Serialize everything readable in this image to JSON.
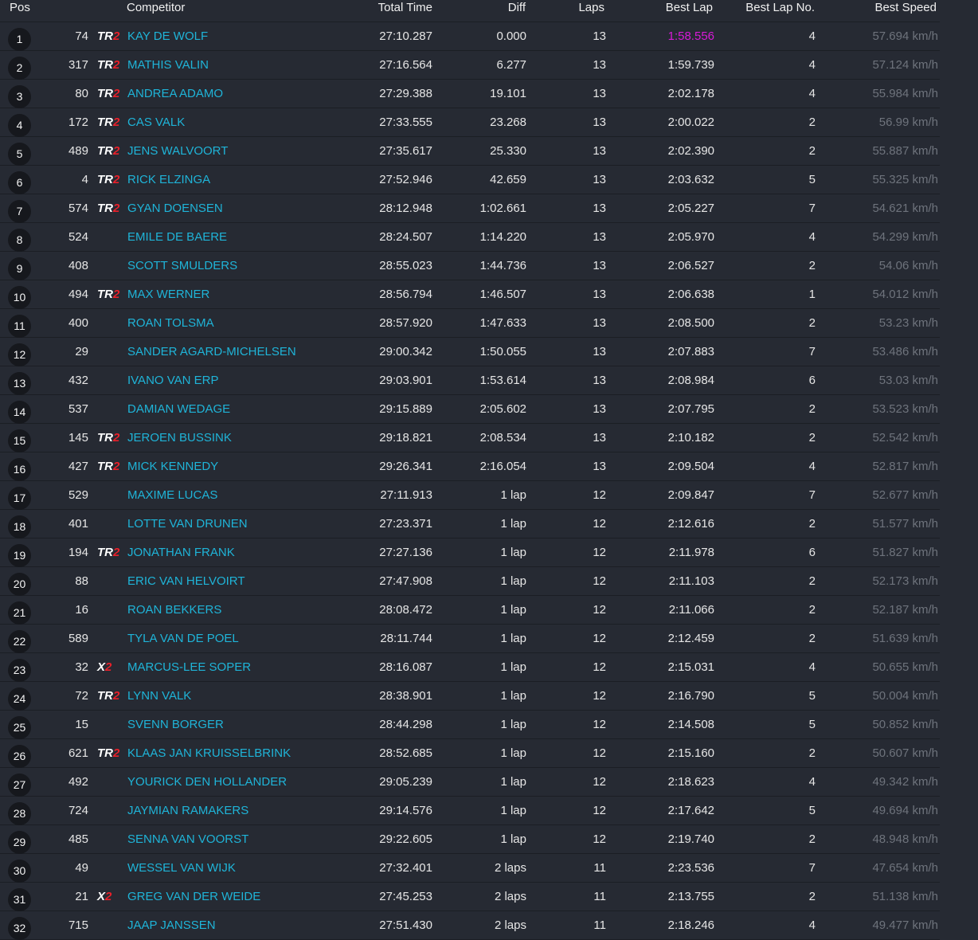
{
  "headers": {
    "pos": "Pos",
    "competitor": "Competitor",
    "total_time": "Total Time",
    "diff": "Diff",
    "laps": "Laps",
    "best_lap": "Best Lap",
    "best_lap_no": "Best Lap No.",
    "best_speed": "Best Speed"
  },
  "colors": {
    "name": "#1fb4d8",
    "fastest_lap": "#d81ad8",
    "class_red": "#e8202a",
    "speed": "#6e737c"
  },
  "rows": [
    {
      "pos": "1",
      "num": "74",
      "cls_a": "TR",
      "cls_b": "2",
      "name": "KAY DE WOLF",
      "total": "27:10.287",
      "diff": "0.000",
      "laps": "13",
      "best": "1:58.556",
      "best_no": "4",
      "speed": "57.694 km/h",
      "fastest": true
    },
    {
      "pos": "2",
      "num": "317",
      "cls_a": "TR",
      "cls_b": "2",
      "name": "MATHIS VALIN",
      "total": "27:16.564",
      "diff": "6.277",
      "laps": "13",
      "best": "1:59.739",
      "best_no": "4",
      "speed": "57.124 km/h"
    },
    {
      "pos": "3",
      "num": "80",
      "cls_a": "TR",
      "cls_b": "2",
      "name": "ANDREA ADAMO",
      "total": "27:29.388",
      "diff": "19.101",
      "laps": "13",
      "best": "2:02.178",
      "best_no": "4",
      "speed": "55.984 km/h"
    },
    {
      "pos": "4",
      "num": "172",
      "cls_a": "TR",
      "cls_b": "2",
      "name": "CAS VALK",
      "total": "27:33.555",
      "diff": "23.268",
      "laps": "13",
      "best": "2:00.022",
      "best_no": "2",
      "speed": "56.99 km/h"
    },
    {
      "pos": "5",
      "num": "489",
      "cls_a": "TR",
      "cls_b": "2",
      "name": "JENS WALVOORT",
      "total": "27:35.617",
      "diff": "25.330",
      "laps": "13",
      "best": "2:02.390",
      "best_no": "2",
      "speed": "55.887 km/h"
    },
    {
      "pos": "6",
      "num": "4",
      "cls_a": "TR",
      "cls_b": "2",
      "name": "RICK ELZINGA",
      "total": "27:52.946",
      "diff": "42.659",
      "laps": "13",
      "best": "2:03.632",
      "best_no": "5",
      "speed": "55.325 km/h"
    },
    {
      "pos": "7",
      "num": "574",
      "cls_a": "TR",
      "cls_b": "2",
      "name": "GYAN DOENSEN",
      "total": "28:12.948",
      "diff": "1:02.661",
      "laps": "13",
      "best": "2:05.227",
      "best_no": "7",
      "speed": "54.621 km/h"
    },
    {
      "pos": "8",
      "num": "524",
      "cls_a": "",
      "cls_b": "",
      "name": "EMILE DE BAERE",
      "total": "28:24.507",
      "diff": "1:14.220",
      "laps": "13",
      "best": "2:05.970",
      "best_no": "4",
      "speed": "54.299 km/h"
    },
    {
      "pos": "9",
      "num": "408",
      "cls_a": "",
      "cls_b": "",
      "name": "SCOTT SMULDERS",
      "total": "28:55.023",
      "diff": "1:44.736",
      "laps": "13",
      "best": "2:06.527",
      "best_no": "2",
      "speed": "54.06 km/h"
    },
    {
      "pos": "10",
      "num": "494",
      "cls_a": "TR",
      "cls_b": "2",
      "name": "MAX WERNER",
      "total": "28:56.794",
      "diff": "1:46.507",
      "laps": "13",
      "best": "2:06.638",
      "best_no": "1",
      "speed": "54.012 km/h"
    },
    {
      "pos": "11",
      "num": "400",
      "cls_a": "",
      "cls_b": "",
      "name": "ROAN TOLSMA",
      "total": "28:57.920",
      "diff": "1:47.633",
      "laps": "13",
      "best": "2:08.500",
      "best_no": "2",
      "speed": "53.23 km/h"
    },
    {
      "pos": "12",
      "num": "29",
      "cls_a": "",
      "cls_b": "",
      "name": "SANDER AGARD-MICHELSEN",
      "total": "29:00.342",
      "diff": "1:50.055",
      "laps": "13",
      "best": "2:07.883",
      "best_no": "7",
      "speed": "53.486 km/h"
    },
    {
      "pos": "13",
      "num": "432",
      "cls_a": "",
      "cls_b": "",
      "name": "IVANO VAN ERP",
      "total": "29:03.901",
      "diff": "1:53.614",
      "laps": "13",
      "best": "2:08.984",
      "best_no": "6",
      "speed": "53.03 km/h"
    },
    {
      "pos": "14",
      "num": "537",
      "cls_a": "",
      "cls_b": "",
      "name": "DAMIAN WEDAGE",
      "total": "29:15.889",
      "diff": "2:05.602",
      "laps": "13",
      "best": "2:07.795",
      "best_no": "2",
      "speed": "53.523 km/h"
    },
    {
      "pos": "15",
      "num": "145",
      "cls_a": "TR",
      "cls_b": "2",
      "name": "JEROEN BUSSINK",
      "total": "29:18.821",
      "diff": "2:08.534",
      "laps": "13",
      "best": "2:10.182",
      "best_no": "2",
      "speed": "52.542 km/h"
    },
    {
      "pos": "16",
      "num": "427",
      "cls_a": "TR",
      "cls_b": "2",
      "name": "MICK KENNEDY",
      "total": "29:26.341",
      "diff": "2:16.054",
      "laps": "13",
      "best": "2:09.504",
      "best_no": "4",
      "speed": "52.817 km/h"
    },
    {
      "pos": "17",
      "num": "529",
      "cls_a": "",
      "cls_b": "",
      "name": "MAXIME LUCAS",
      "total": "27:11.913",
      "diff": "1 lap",
      "laps": "12",
      "best": "2:09.847",
      "best_no": "7",
      "speed": "52.677 km/h"
    },
    {
      "pos": "18",
      "num": "401",
      "cls_a": "",
      "cls_b": "",
      "name": "LOTTE VAN DRUNEN",
      "total": "27:23.371",
      "diff": "1 lap",
      "laps": "12",
      "best": "2:12.616",
      "best_no": "2",
      "speed": "51.577 km/h"
    },
    {
      "pos": "19",
      "num": "194",
      "cls_a": "TR",
      "cls_b": "2",
      "name": "JONATHAN FRANK",
      "total": "27:27.136",
      "diff": "1 lap",
      "laps": "12",
      "best": "2:11.978",
      "best_no": "6",
      "speed": "51.827 km/h"
    },
    {
      "pos": "20",
      "num": "88",
      "cls_a": "",
      "cls_b": "",
      "name": "ERIC VAN HELVOIRT",
      "total": "27:47.908",
      "diff": "1 lap",
      "laps": "12",
      "best": "2:11.103",
      "best_no": "2",
      "speed": "52.173 km/h"
    },
    {
      "pos": "21",
      "num": "16",
      "cls_a": "",
      "cls_b": "",
      "name": "ROAN BEKKERS",
      "total": "28:08.472",
      "diff": "1 lap",
      "laps": "12",
      "best": "2:11.066",
      "best_no": "2",
      "speed": "52.187 km/h"
    },
    {
      "pos": "22",
      "num": "589",
      "cls_a": "",
      "cls_b": "",
      "name": "TYLA VAN DE POEL",
      "total": "28:11.744",
      "diff": "1 lap",
      "laps": "12",
      "best": "2:12.459",
      "best_no": "2",
      "speed": "51.639 km/h"
    },
    {
      "pos": "23",
      "num": "32",
      "cls_a": "X",
      "cls_b": "2",
      "name": "MARCUS-LEE SOPER",
      "total": "28:16.087",
      "diff": "1 lap",
      "laps": "12",
      "best": "2:15.031",
      "best_no": "4",
      "speed": "50.655 km/h"
    },
    {
      "pos": "24",
      "num": "72",
      "cls_a": "TR",
      "cls_b": "2",
      "name": "LYNN VALK",
      "total": "28:38.901",
      "diff": "1 lap",
      "laps": "12",
      "best": "2:16.790",
      "best_no": "5",
      "speed": "50.004 km/h"
    },
    {
      "pos": "25",
      "num": "15",
      "cls_a": "",
      "cls_b": "",
      "name": "SVENN BORGER",
      "total": "28:44.298",
      "diff": "1 lap",
      "laps": "12",
      "best": "2:14.508",
      "best_no": "5",
      "speed": "50.852 km/h"
    },
    {
      "pos": "26",
      "num": "621",
      "cls_a": "TR",
      "cls_b": "2",
      "name": "KLAAS JAN KRUISSELBRINK",
      "total": "28:52.685",
      "diff": "1 lap",
      "laps": "12",
      "best": "2:15.160",
      "best_no": "2",
      "speed": "50.607 km/h"
    },
    {
      "pos": "27",
      "num": "492",
      "cls_a": "",
      "cls_b": "",
      "name": "YOURICK DEN HOLLANDER",
      "total": "29:05.239",
      "diff": "1 lap",
      "laps": "12",
      "best": "2:18.623",
      "best_no": "4",
      "speed": "49.342 km/h"
    },
    {
      "pos": "28",
      "num": "724",
      "cls_a": "",
      "cls_b": "",
      "name": "JAYMIAN RAMAKERS",
      "total": "29:14.576",
      "diff": "1 lap",
      "laps": "12",
      "best": "2:17.642",
      "best_no": "5",
      "speed": "49.694 km/h"
    },
    {
      "pos": "29",
      "num": "485",
      "cls_a": "",
      "cls_b": "",
      "name": "SENNA VAN VOORST",
      "total": "29:22.605",
      "diff": "1 lap",
      "laps": "12",
      "best": "2:19.740",
      "best_no": "2",
      "speed": "48.948 km/h"
    },
    {
      "pos": "30",
      "num": "49",
      "cls_a": "",
      "cls_b": "",
      "name": "WESSEL VAN WIJK",
      "total": "27:32.401",
      "diff": "2 laps",
      "laps": "11",
      "best": "2:23.536",
      "best_no": "7",
      "speed": "47.654 km/h"
    },
    {
      "pos": "31",
      "num": "21",
      "cls_a": "X",
      "cls_b": "2",
      "name": "GREG VAN DER WEIDE",
      "total": "27:45.253",
      "diff": "2 laps",
      "laps": "11",
      "best": "2:13.755",
      "best_no": "2",
      "speed": "51.138 km/h"
    },
    {
      "pos": "32",
      "num": "715",
      "cls_a": "",
      "cls_b": "",
      "name": "JAAP JANSSEN",
      "total": "27:51.430",
      "diff": "2 laps",
      "laps": "11",
      "best": "2:18.246",
      "best_no": "4",
      "speed": "49.477 km/h"
    }
  ]
}
